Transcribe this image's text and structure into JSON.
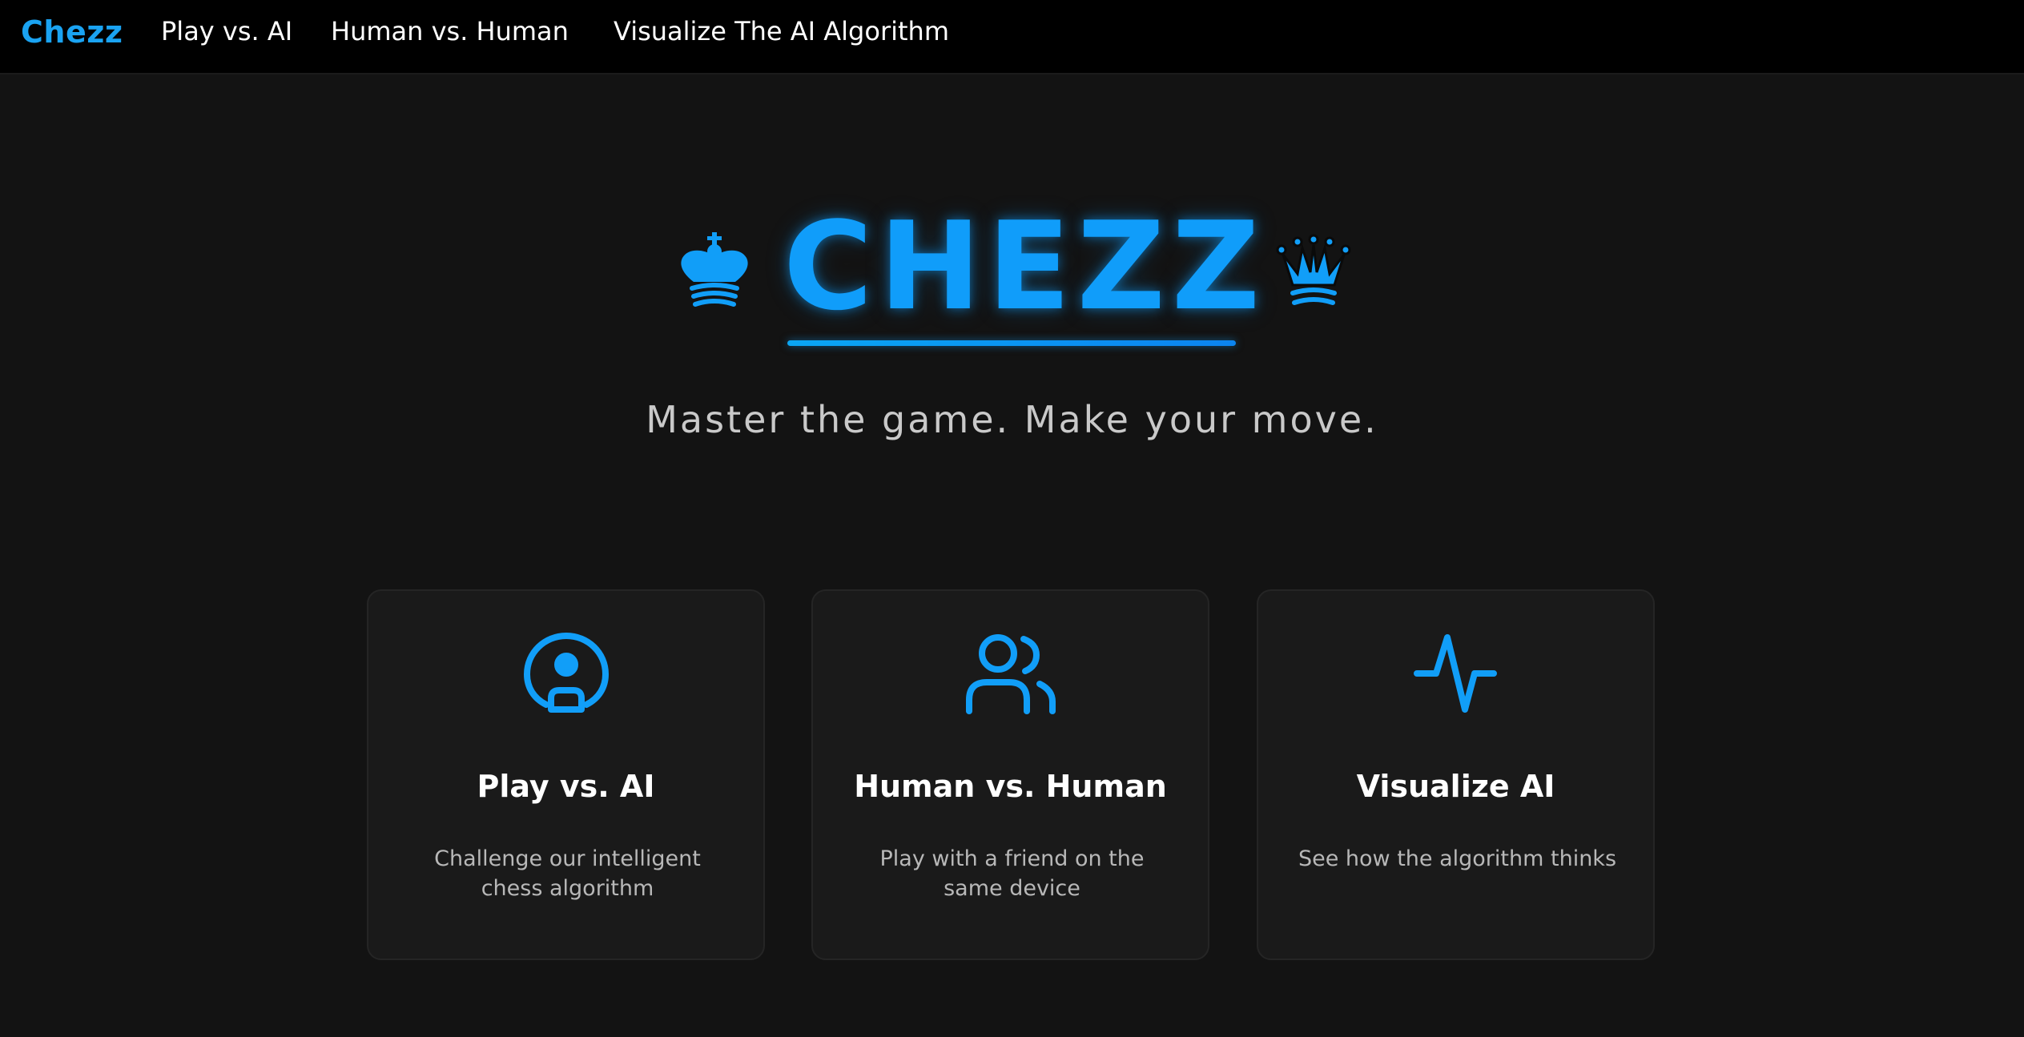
{
  "nav": {
    "brand": "Chezz",
    "links": [
      "Play vs. AI",
      "Human vs. Human",
      "Visualize The AI Algorithm"
    ]
  },
  "hero": {
    "title": "CHEZZ",
    "tagline": "Master the game. Make your move.",
    "left_icon": "chess-king-icon",
    "right_icon": "chess-queen-icon"
  },
  "cards": [
    {
      "icon": "robot-icon",
      "title": "Play vs. AI",
      "description": "Challenge our intelligent chess algorithm"
    },
    {
      "icon": "users-icon",
      "title": "Human vs. Human",
      "description": "Play with a friend on the same device"
    },
    {
      "icon": "activity-icon",
      "title": "Visualize AI",
      "description": "See how the algorithm thinks"
    }
  ],
  "colors": {
    "accent": "#109dfa",
    "background": "#131313",
    "navbar": "#000000",
    "card": "#1a1a1a",
    "text": "#ffffff",
    "muted_text": "#b8b8b8"
  }
}
